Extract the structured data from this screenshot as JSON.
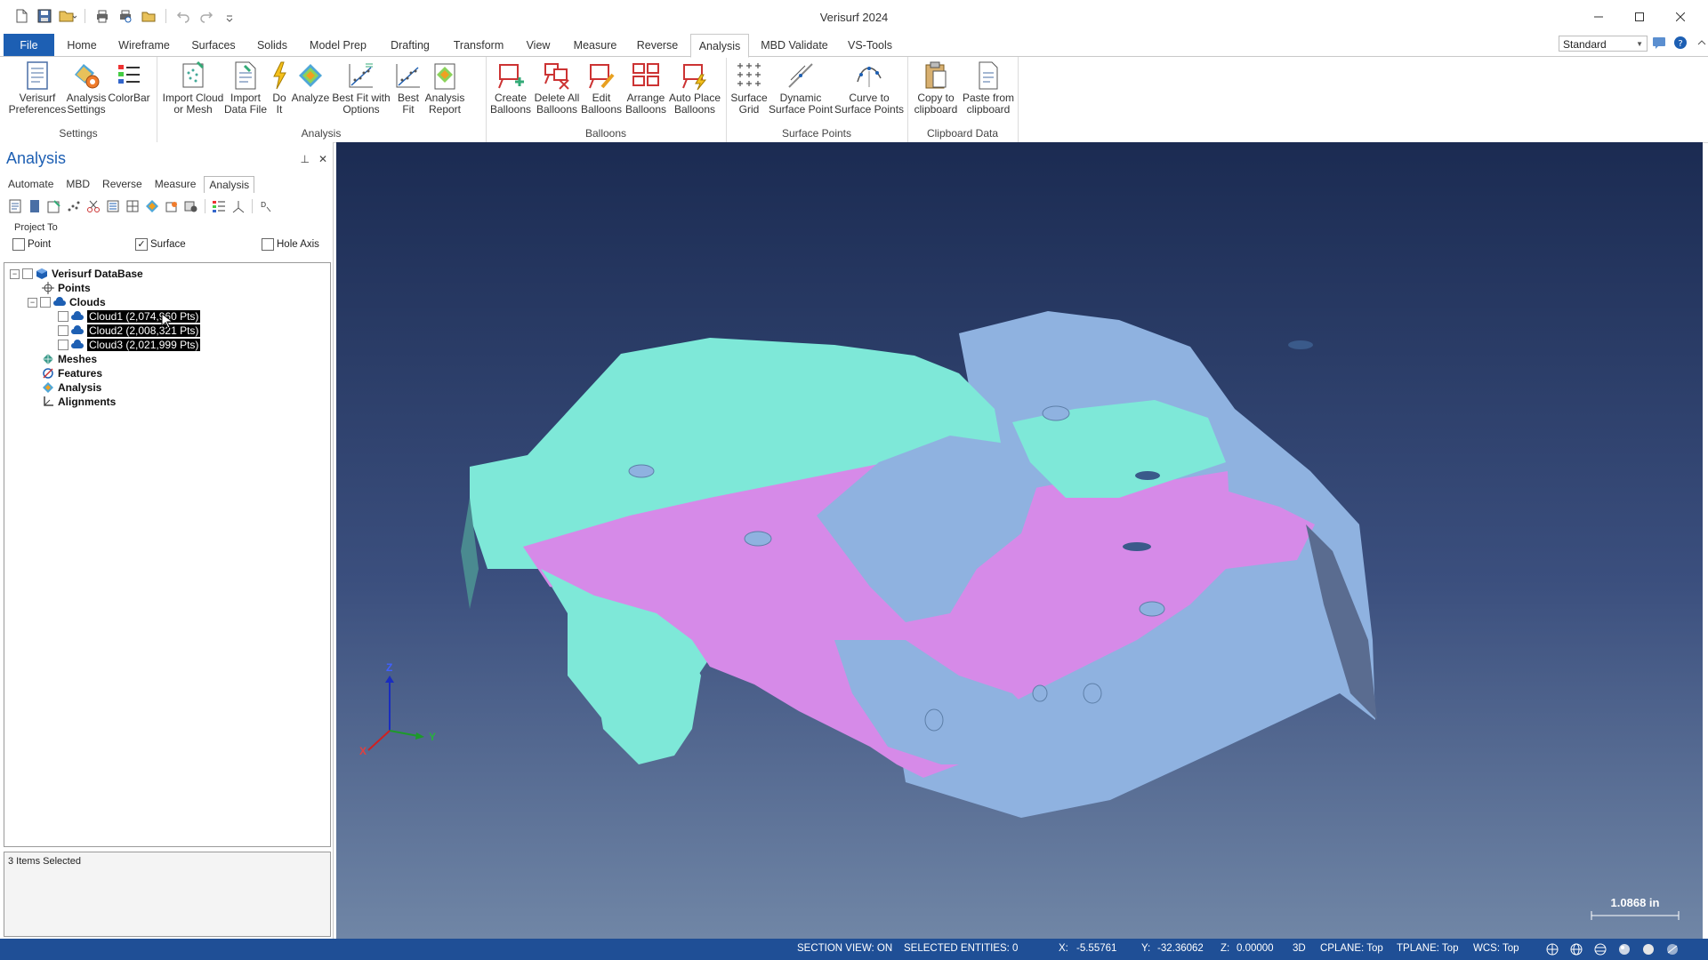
{
  "app": {
    "title": "Verisurf 2024"
  },
  "window_controls": [
    "minimize",
    "maximize",
    "close"
  ],
  "quick_access": [
    "new-icon",
    "save-icon",
    "open-icon",
    "print-icon",
    "print-preview-icon",
    "folder-icon",
    "undo-icon",
    "redo-icon",
    "customize-icon"
  ],
  "ribbon": {
    "file_tab": "File",
    "tabs": [
      "Home",
      "Wireframe",
      "Surfaces",
      "Solids",
      "Model Prep",
      "Drafting",
      "Transform",
      "View",
      "Measure",
      "Reverse",
      "Analysis",
      "MBD Validate",
      "VS-Tools"
    ],
    "active_tab": "Analysis",
    "workspace": "Standard",
    "groups": [
      {
        "label": "Settings",
        "buttons": [
          "Verisurf\nPreferences",
          "Analysis\nSettings",
          "ColorBar"
        ]
      },
      {
        "label": "Analysis",
        "buttons": [
          "Import Cloud\nor Mesh",
          "Import\nData File",
          "Do\nIt",
          "Analyze",
          "Best Fit with\nOptions",
          "Best\nFit",
          "Analysis\nReport"
        ]
      },
      {
        "label": "Balloons",
        "buttons": [
          "Create\nBalloons",
          "Delete All\nBalloons",
          "Edit\nBalloons",
          "Arrange\nBalloons",
          "Auto Place\nBalloons"
        ]
      },
      {
        "label": "Surface Points",
        "buttons": [
          "Surface\nGrid",
          "Dynamic\nSurface Point",
          "Curve to\nSurface Points"
        ]
      },
      {
        "label": "Clipboard Data",
        "buttons": [
          "Copy to\nclipboard",
          "Paste from\nclipboard"
        ]
      }
    ]
  },
  "panel": {
    "title": "Analysis",
    "subtabs": [
      "Automate",
      "MBD",
      "Reverse",
      "Measure",
      "Analysis"
    ],
    "active_subtab": "Analysis",
    "project_to": {
      "legend": "Project To",
      "options": [
        {
          "label": "Point",
          "checked": false
        },
        {
          "label": "Surface",
          "checked": true
        },
        {
          "label": "Hole Axis",
          "checked": false
        }
      ]
    },
    "tree": {
      "root": "Verisurf DataBase",
      "points": "Points",
      "clouds": "Clouds",
      "cloud_items": [
        "Cloud1 (2,074,960 Pts)",
        "Cloud2 (2,008,321 Pts)",
        "Cloud3 (2,021,999 Pts)"
      ],
      "meshes": "Meshes",
      "features": "Features",
      "analysis": "Analysis",
      "alignments": "Alignments"
    },
    "selection_status": "3 Items Selected"
  },
  "viewport": {
    "scale": "1.0868 in",
    "axes": {
      "x": "X",
      "y": "Y",
      "z": "Z"
    },
    "cloud_colors": {
      "cloud1": "#7ee8d8",
      "cloud2": "#d68ae8",
      "cloud3": "#8fb2e0"
    }
  },
  "statusbar": {
    "section_view": "SECTION VIEW: ON",
    "selected": "SELECTED ENTITIES: 0",
    "x_label": "X:",
    "x": "-5.55761",
    "y_label": "Y:",
    "y": "-32.36062",
    "z_label": "Z:",
    "z": "0.00000",
    "mode": "3D",
    "cplane": "CPLANE: Top",
    "tplane": "TPLANE: Top",
    "wcs": "WCS: Top"
  }
}
